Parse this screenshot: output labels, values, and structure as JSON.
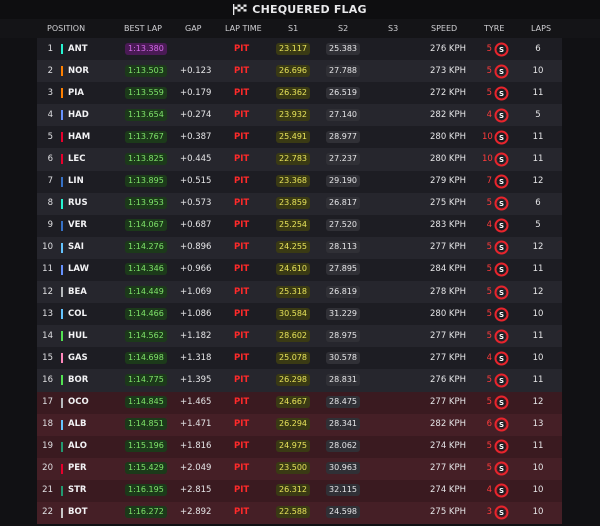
{
  "header": {
    "title": "CHEQUERED FLAG",
    "flag_icon": "chequered-flag-icon"
  },
  "columns": [
    "POSITION",
    "BEST LAP",
    "GAP",
    "LAP TIME",
    "S1",
    "S2",
    "S3",
    "SPEED",
    "TYRE",
    "LAPS"
  ],
  "colors": {
    "fastest_lap": "#d46ae8",
    "personal_best": "#7fe36a",
    "pit": "#ff2a2a",
    "tyre_soft": "#e8242c",
    "row_highlight": "#451f26"
  },
  "rows": [
    {
      "pos": "1",
      "team_color": "#27f4d2",
      "code": "ANT",
      "best_lap": "1:13.380",
      "fastest": true,
      "gap": "",
      "status": "PIT",
      "s1": "23.117",
      "s2": "25.383",
      "s3": "",
      "speed": "276 KPH",
      "tyre_age": "5",
      "tyre": "S",
      "laps": "6",
      "highlight": false
    },
    {
      "pos": "2",
      "team_color": "#ff8000",
      "code": "NOR",
      "best_lap": "1:13.503",
      "fastest": false,
      "gap": "+0.123",
      "status": "PIT",
      "s1": "26.696",
      "s2": "27.788",
      "s3": "",
      "speed": "273 KPH",
      "tyre_age": "5",
      "tyre": "S",
      "laps": "10",
      "highlight": false
    },
    {
      "pos": "3",
      "team_color": "#ff8000",
      "code": "PIA",
      "best_lap": "1:13.559",
      "fastest": false,
      "gap": "+0.179",
      "status": "PIT",
      "s1": "26.362",
      "s2": "26.519",
      "s3": "",
      "speed": "272 KPH",
      "tyre_age": "5",
      "tyre": "S",
      "laps": "11",
      "highlight": false
    },
    {
      "pos": "4",
      "team_color": "#6692ff",
      "code": "HAD",
      "best_lap": "1:13.654",
      "fastest": false,
      "gap": "+0.274",
      "status": "PIT",
      "s1": "23.932",
      "s2": "27.140",
      "s3": "",
      "speed": "282 KPH",
      "tyre_age": "4",
      "tyre": "S",
      "laps": "5",
      "highlight": false
    },
    {
      "pos": "5",
      "team_color": "#e8002d",
      "code": "HAM",
      "best_lap": "1:13.767",
      "fastest": false,
      "gap": "+0.387",
      "status": "PIT",
      "s1": "25.491",
      "s2": "28.977",
      "s3": "",
      "speed": "280 KPH",
      "tyre_age": "10",
      "tyre": "S",
      "laps": "11",
      "highlight": false
    },
    {
      "pos": "6",
      "team_color": "#e8002d",
      "code": "LEC",
      "best_lap": "1:13.825",
      "fastest": false,
      "gap": "+0.445",
      "status": "PIT",
      "s1": "22.783",
      "s2": "27.237",
      "s3": "",
      "speed": "280 KPH",
      "tyre_age": "10",
      "tyre": "S",
      "laps": "11",
      "highlight": false
    },
    {
      "pos": "7",
      "team_color": "#3671c6",
      "code": "LIN",
      "best_lap": "1:13.895",
      "fastest": false,
      "gap": "+0.515",
      "status": "PIT",
      "s1": "23.368",
      "s2": "29.190",
      "s3": "",
      "speed": "279 KPH",
      "tyre_age": "7",
      "tyre": "S",
      "laps": "12",
      "highlight": false
    },
    {
      "pos": "8",
      "team_color": "#27f4d2",
      "code": "RUS",
      "best_lap": "1:13.953",
      "fastest": false,
      "gap": "+0.573",
      "status": "PIT",
      "s1": "23.859",
      "s2": "26.817",
      "s3": "",
      "speed": "275 KPH",
      "tyre_age": "5",
      "tyre": "S",
      "laps": "6",
      "highlight": false
    },
    {
      "pos": "9",
      "team_color": "#3671c6",
      "code": "VER",
      "best_lap": "1:14.067",
      "fastest": false,
      "gap": "+0.687",
      "status": "PIT",
      "s1": "25.254",
      "s2": "27.520",
      "s3": "",
      "speed": "283 KPH",
      "tyre_age": "4",
      "tyre": "S",
      "laps": "5",
      "highlight": false
    },
    {
      "pos": "10",
      "team_color": "#64c4ff",
      "code": "SAI",
      "best_lap": "1:14.276",
      "fastest": false,
      "gap": "+0.896",
      "status": "PIT",
      "s1": "24.255",
      "s2": "28.113",
      "s3": "",
      "speed": "277 KPH",
      "tyre_age": "5",
      "tyre": "S",
      "laps": "12",
      "highlight": false
    },
    {
      "pos": "11",
      "team_color": "#6692ff",
      "code": "LAW",
      "best_lap": "1:14.346",
      "fastest": false,
      "gap": "+0.966",
      "status": "PIT",
      "s1": "24.610",
      "s2": "27.895",
      "s3": "",
      "speed": "284 KPH",
      "tyre_age": "5",
      "tyre": "S",
      "laps": "11",
      "highlight": false
    },
    {
      "pos": "12",
      "team_color": "#b6babd",
      "code": "BEA",
      "best_lap": "1:14.449",
      "fastest": false,
      "gap": "+1.069",
      "status": "PIT",
      "s1": "25.318",
      "s2": "26.819",
      "s3": "",
      "speed": "278 KPH",
      "tyre_age": "5",
      "tyre": "S",
      "laps": "12",
      "highlight": false
    },
    {
      "pos": "13",
      "team_color": "#64c4ff",
      "code": "COL",
      "best_lap": "1:14.466",
      "fastest": false,
      "gap": "+1.086",
      "status": "PIT",
      "s1": "30.584",
      "s2": "31.229",
      "s3": "",
      "speed": "280 KPH",
      "tyre_age": "5",
      "tyre": "S",
      "laps": "10",
      "highlight": false
    },
    {
      "pos": "14",
      "team_color": "#52e252",
      "code": "HUL",
      "best_lap": "1:14.562",
      "fastest": false,
      "gap": "+1.182",
      "status": "PIT",
      "s1": "28.602",
      "s2": "28.975",
      "s3": "",
      "speed": "277 KPH",
      "tyre_age": "5",
      "tyre": "S",
      "laps": "11",
      "highlight": false
    },
    {
      "pos": "15",
      "team_color": "#ff87bc",
      "code": "GAS",
      "best_lap": "1:14.698",
      "fastest": false,
      "gap": "+1.318",
      "status": "PIT",
      "s1": "25.078",
      "s2": "30.578",
      "s3": "",
      "speed": "277 KPH",
      "tyre_age": "4",
      "tyre": "S",
      "laps": "10",
      "highlight": false
    },
    {
      "pos": "16",
      "team_color": "#52e252",
      "code": "BOR",
      "best_lap": "1:14.775",
      "fastest": false,
      "gap": "+1.395",
      "status": "PIT",
      "s1": "26.298",
      "s2": "28.831",
      "s3": "",
      "speed": "276 KPH",
      "tyre_age": "5",
      "tyre": "S",
      "laps": "11",
      "highlight": false
    },
    {
      "pos": "17",
      "team_color": "#b6babd",
      "code": "OCO",
      "best_lap": "1:14.845",
      "fastest": false,
      "gap": "+1.465",
      "status": "PIT",
      "s1": "24.667",
      "s2": "28.475",
      "s3": "",
      "speed": "277 KPH",
      "tyre_age": "5",
      "tyre": "S",
      "laps": "12",
      "highlight": true
    },
    {
      "pos": "18",
      "team_color": "#64c4ff",
      "code": "ALB",
      "best_lap": "1:14.851",
      "fastest": false,
      "gap": "+1.471",
      "status": "PIT",
      "s1": "26.294",
      "s2": "28.341",
      "s3": "",
      "speed": "282 KPH",
      "tyre_age": "6",
      "tyre": "S",
      "laps": "13",
      "highlight": true
    },
    {
      "pos": "19",
      "team_color": "#229971",
      "code": "ALO",
      "best_lap": "1:15.196",
      "fastest": false,
      "gap": "+1.816",
      "status": "PIT",
      "s1": "24.975",
      "s2": "28.062",
      "s3": "",
      "speed": "274 KPH",
      "tyre_age": "5",
      "tyre": "S",
      "laps": "11",
      "highlight": true
    },
    {
      "pos": "20",
      "team_color": "#e8002d",
      "code": "PER",
      "best_lap": "1:15.429",
      "fastest": false,
      "gap": "+2.049",
      "status": "PIT",
      "s1": "23.500",
      "s2": "30.963",
      "s3": "",
      "speed": "277 KPH",
      "tyre_age": "5",
      "tyre": "S",
      "laps": "10",
      "highlight": true
    },
    {
      "pos": "21",
      "team_color": "#229971",
      "code": "STR",
      "best_lap": "1:16.195",
      "fastest": false,
      "gap": "+2.815",
      "status": "PIT",
      "s1": "26.312",
      "s2": "32.115",
      "s3": "",
      "speed": "274 KPH",
      "tyre_age": "4",
      "tyre": "S",
      "laps": "10",
      "highlight": true
    },
    {
      "pos": "22",
      "team_color": "#c8c8c8",
      "code": "BOT",
      "best_lap": "1:16.272",
      "fastest": false,
      "gap": "+2.892",
      "status": "PIT",
      "s1": "22.588",
      "s2": "24.598",
      "s3": "",
      "speed": "275 KPH",
      "tyre_age": "3",
      "tyre": "S",
      "laps": "10",
      "highlight": true
    }
  ]
}
